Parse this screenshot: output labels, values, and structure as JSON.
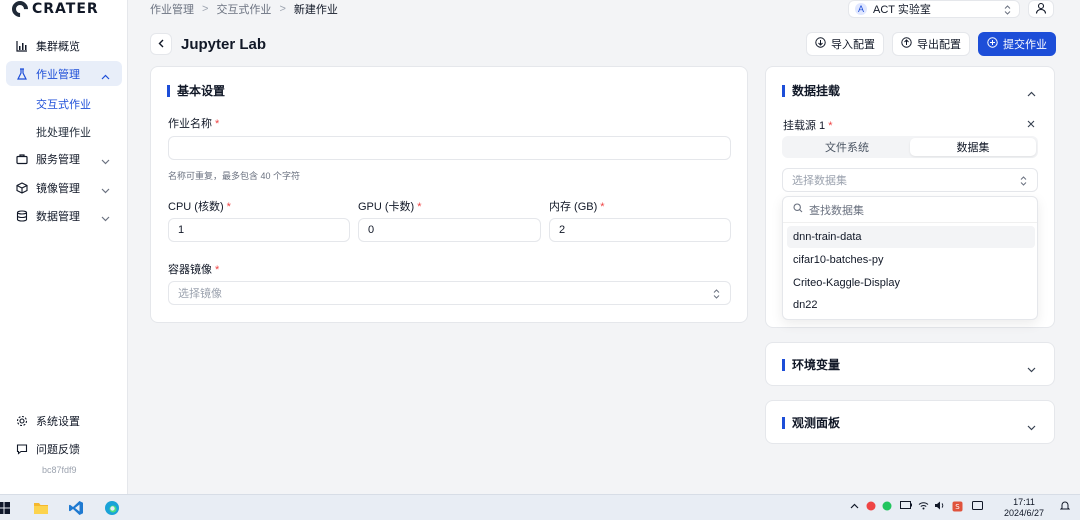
{
  "app": {
    "logo_text": "CRATER",
    "version_hash": "bc87fdf9"
  },
  "sidebar": {
    "items": [
      {
        "label": "集群概览",
        "icon": "bar-chart-icon"
      },
      {
        "label": "作业管理",
        "icon": "flask-icon",
        "expanded": true
      },
      {
        "label": "服务管理",
        "icon": "briefcase-icon"
      },
      {
        "label": "镜像管理",
        "icon": "box-icon"
      },
      {
        "label": "数据管理",
        "icon": "database-icon"
      }
    ],
    "sub_items": [
      {
        "label": "交互式作业",
        "active": true
      },
      {
        "label": "批处理作业",
        "active": false
      }
    ],
    "bottom": [
      {
        "label": "系统设置",
        "icon": "gear-icon"
      },
      {
        "label": "问题反馈",
        "icon": "message-icon"
      }
    ]
  },
  "header": {
    "breadcrumb": [
      "作业管理",
      "交互式作业",
      "新建作业"
    ],
    "org_badge": "A",
    "org_label": "ACT 实验室",
    "page_title": "Jupyter Lab",
    "import_label": "导入配置",
    "export_label": "导出配置",
    "submit_label": "提交作业"
  },
  "basic": {
    "title": "基本设置",
    "job_name": {
      "label": "作业名称",
      "value": "",
      "hint": "名称可重复，最多包含 40 个字符"
    },
    "cpu": {
      "label": "CPU (核数)",
      "value": "1"
    },
    "gpu": {
      "label": "GPU (卡数)",
      "value": "0"
    },
    "memory": {
      "label": "内存 (GB)",
      "value": "2"
    },
    "image": {
      "label": "容器镜像",
      "placeholder": "选择镜像"
    }
  },
  "mount": {
    "title": "数据挂载",
    "source_label": "挂载源 1",
    "tabs": [
      {
        "label": "文件系统",
        "active": false
      },
      {
        "label": "数据集",
        "active": true
      }
    ],
    "select_placeholder": "选择数据集",
    "search_placeholder": "查找数据集",
    "options": [
      "dnn-train-data",
      "cifar10-batches-py",
      "Criteo-Kaggle-Display",
      "dn22"
    ]
  },
  "env": {
    "title": "环境变量"
  },
  "monitor": {
    "title": "观测面板"
  },
  "taskbar": {
    "time": "17:11",
    "date": "2024/6/27"
  },
  "colors": {
    "accent": "#1d4ed8",
    "required": "#ef4444",
    "active_bg": "#e8eef9"
  }
}
